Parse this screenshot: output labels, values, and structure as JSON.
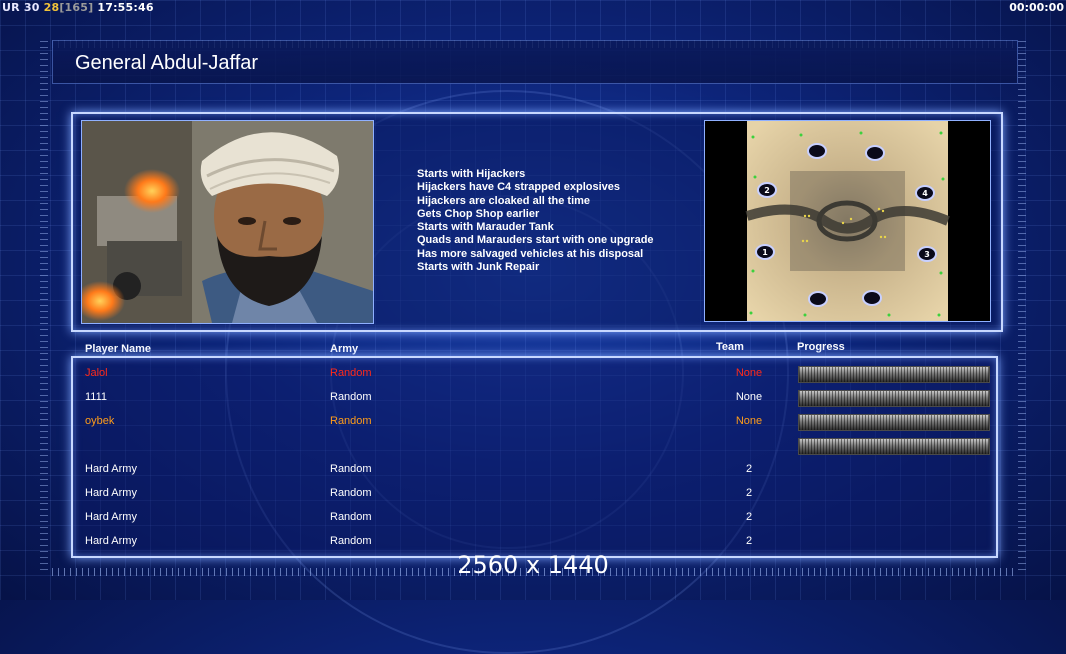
{
  "hud": {
    "ur_label": "UR",
    "value_a": "30",
    "value_b": "28",
    "value_c": "[165]",
    "clock": "17:55:46",
    "timer": "00:00:00"
  },
  "title": "General Abdul-Jaffar",
  "description": [
    "Starts with Hijackers",
    "Hijackers have C4 strapped explosives",
    "Hijackers are cloaked all the time",
    "Gets Chop Shop earlier",
    "Starts with Marauder Tank",
    "Quads and Marauders start with one upgrade",
    "Has more salvaged vehicles at his disposal",
    "Starts with Junk Repair"
  ],
  "minimap": {
    "start_positions": [
      "1",
      "2",
      "3",
      "4"
    ]
  },
  "table": {
    "headers": {
      "player_name": "Player Name",
      "army": "Army",
      "team": "Team",
      "progress": "Progress"
    },
    "rows": [
      {
        "name": "Jalol",
        "army": "Random",
        "team": "None",
        "color": "#ff2a1a",
        "progress": 1.0
      },
      {
        "name": "1111",
        "army": "Random",
        "team": "None",
        "color": "#ffffff",
        "progress": 1.0
      },
      {
        "name": "oybek",
        "army": "Random",
        "team": "None",
        "color": "#ff9d1a",
        "progress": 1.0
      },
      {
        "name": "",
        "army": "",
        "team": "",
        "color": "#1a2dff",
        "progress": 1.0
      },
      {
        "name": "Hard Army",
        "army": "Random",
        "team": "2",
        "color": "#ffffff",
        "progress": null
      },
      {
        "name": "Hard Army",
        "army": "Random",
        "team": "2",
        "color": "#ffffff",
        "progress": null
      },
      {
        "name": "Hard Army",
        "army": "Random",
        "team": "2",
        "color": "#ffffff",
        "progress": null
      },
      {
        "name": "Hard Army",
        "army": "Random",
        "team": "2",
        "color": "#ffffff",
        "progress": null
      }
    ]
  },
  "resolution_overlay": "2560 x 1440"
}
